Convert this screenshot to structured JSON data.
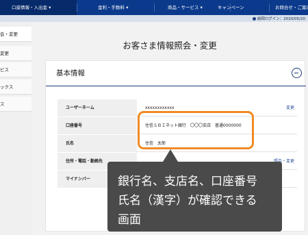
{
  "topnav": {
    "items": [
      "口座情報・入出金 ▾",
      "金利・手数料 ▾",
      "商品・サービス ▾",
      "キャンペーン",
      "お問合せ・ご案内"
    ]
  },
  "subbar": {
    "last_login": "前回ログイン：2020/05/20"
  },
  "sidebar": {
    "items": [
      "会・変更",
      "変更",
      "ビス",
      "ックス",
      "ス"
    ]
  },
  "page": {
    "title": "お客さま情報照会・変更"
  },
  "card": {
    "title": "基本情報",
    "rows": [
      {
        "label": "ユーザーネーム",
        "value": "xxxxxxxxxxxx",
        "link": "変更"
      },
      {
        "label": "口座番号",
        "value": "住信ＳＢＩネット銀行　〇〇〇支店　普通0000000",
        "link": ""
      },
      {
        "label": "氏名",
        "value": "住信　太郎",
        "link": ""
      },
      {
        "label": "住所・電話・勤務先",
        "value": "…",
        "link": "照会・変更"
      },
      {
        "label": "マイナンバー",
        "value": "",
        "link": ""
      }
    ]
  },
  "callout": {
    "lines": [
      "銀行名、支店名、口座番号",
      "氏名（漢字）が確認できる",
      "画面"
    ]
  },
  "colors": {
    "nav": "#0b3a8c",
    "highlight": "#f08a24",
    "callout": "#4a4a4a"
  }
}
